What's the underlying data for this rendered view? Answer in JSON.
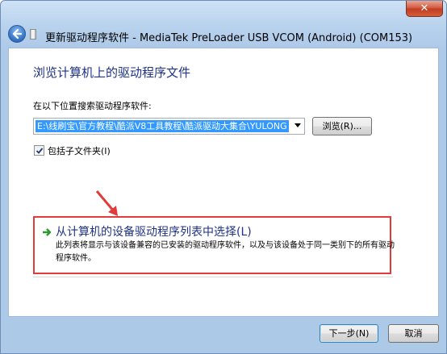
{
  "window": {
    "title": "更新驱动程序软件 - MediaTek PreLoader USB VCOM (Android) (COM153)",
    "close_label": "✕"
  },
  "page": {
    "heading": "浏览计算机上的驱动程序文件",
    "search_label": "在以下位置搜索驱动程序软件:",
    "path_value": "E:\\线刷宝\\官方教程\\酷派V8工具教程\\酷派驱动大集合\\YULONG",
    "browse_label": "浏览(R)...",
    "include_subfolders": {
      "label": "包括子文件夹(I)",
      "checked": true
    }
  },
  "pick_option": {
    "title": "从计算机的设备驱动程序列表中选择(L)",
    "description": "此列表将显示与该设备兼容的已安装的驱动程序软件，以及与该设备处于同一类别下的所有驱动程序软件。"
  },
  "buttons": {
    "next_label": "下一步(N)",
    "cancel_label": "取消"
  },
  "colors": {
    "heading": "#1e3287",
    "annotation": "#e03c3c",
    "selection": "#3399ff"
  }
}
